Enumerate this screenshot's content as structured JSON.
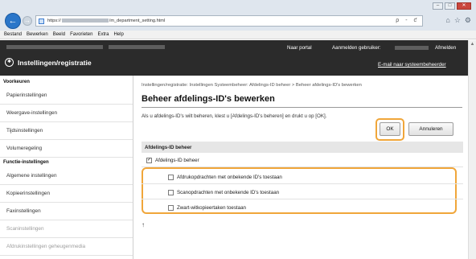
{
  "browser": {
    "url_prefix": "https://",
    "url_suffix": "/m_department_setting.html",
    "address_controls": "ρ - ƈ",
    "tool_icons": [
      "home-icon",
      "star-icon",
      "gear-icon"
    ],
    "window_buttons": [
      "–",
      "□",
      "✕"
    ],
    "menu": [
      "Bestand",
      "Bewerken",
      "Beeld",
      "Favorieten",
      "Extra",
      "Help"
    ]
  },
  "header": {
    "title": "Instellingen/registratie",
    "portal_link": "Naar portal",
    "login_label": "Aanmelden gebruiker:",
    "logout_link": "Afmelden",
    "mail_link": "E-mail naar systeembeheerder"
  },
  "sidebar": {
    "group1": "Voorkeuren",
    "items1": [
      "Papierinstellingen",
      "Weergave-instellingen",
      "Tijdsinstellingen",
      "Volumeregeling"
    ],
    "group2": "Functie-instellingen",
    "items2": [
      "Algemene instellingen",
      "Kopieerinstellingen",
      "Faxinstellingen",
      "Scaninstellingen",
      "Afdrukinstellingen geheugenmedia"
    ]
  },
  "main": {
    "breadcrumb": "Instellingen/registratie: Instellingen Systeembeheer: Afdelings-ID beheer > Beheer afdelings-ID's bewerken",
    "title": "Beheer afdelings-ID's bewerken",
    "info": "Als u afdelings-ID's wilt beheren, klest u [Afdelings-ID's beheren] en drukt u op [OK].",
    "ok_label": "OK",
    "cancel_label": "Annuleren",
    "section_title": "Afdelings-ID beheer",
    "main_checkbox": {
      "label": "Afdelings-ID beheer",
      "checked": true
    },
    "options": [
      {
        "label": "Afdrukopdrachten met onbekende ID's toestaan",
        "checked": false
      },
      {
        "label": "Scanopdrachten met onbekende ID's toestaan",
        "checked": false
      },
      {
        "label": "Zwart-witkopieertaken toestaan",
        "checked": false
      }
    ],
    "top_link": "↑"
  },
  "colors": {
    "highlight": "#f0a63a",
    "header_bg": "#2b2b2b",
    "back_button": "#2a76c9"
  }
}
